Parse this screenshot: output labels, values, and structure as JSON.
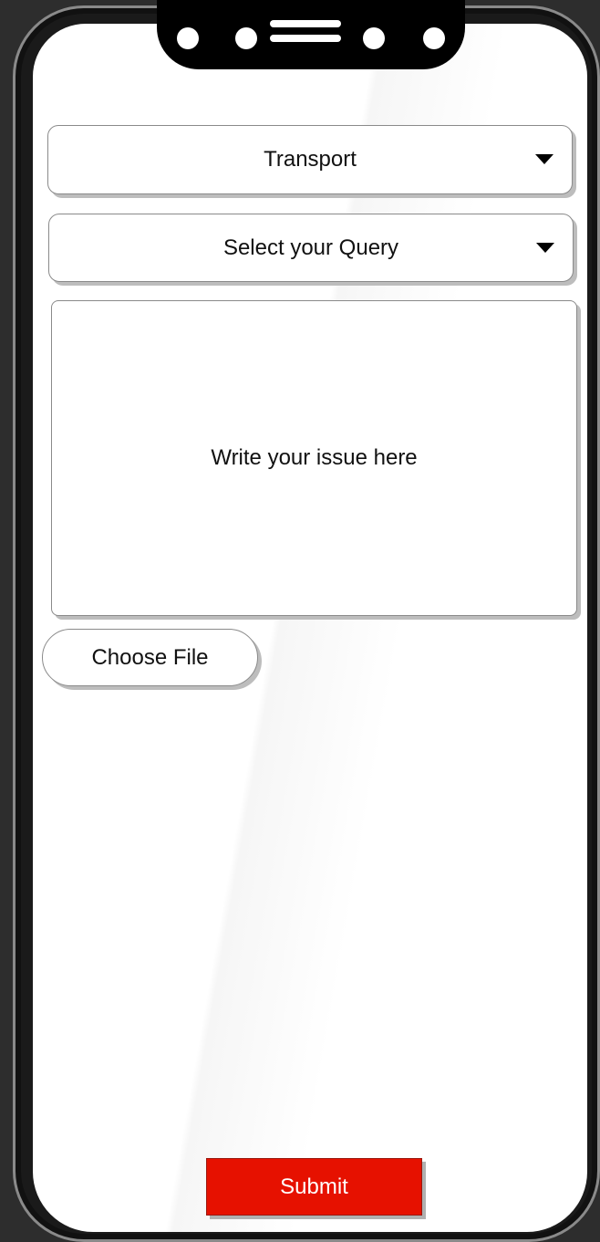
{
  "form": {
    "category_select": {
      "value": "Transport",
      "icon": "caret-down-icon"
    },
    "query_select": {
      "value": "Select your Query",
      "icon": "caret-down-icon"
    },
    "issue_textarea": {
      "placeholder": "Write your issue here"
    },
    "file_button": {
      "label": "Choose File"
    },
    "submit_button": {
      "label": "Submit",
      "color": "#e61100"
    }
  },
  "theme": {
    "frame_color": "#1a1a1a",
    "background": "#2d2d2d"
  }
}
